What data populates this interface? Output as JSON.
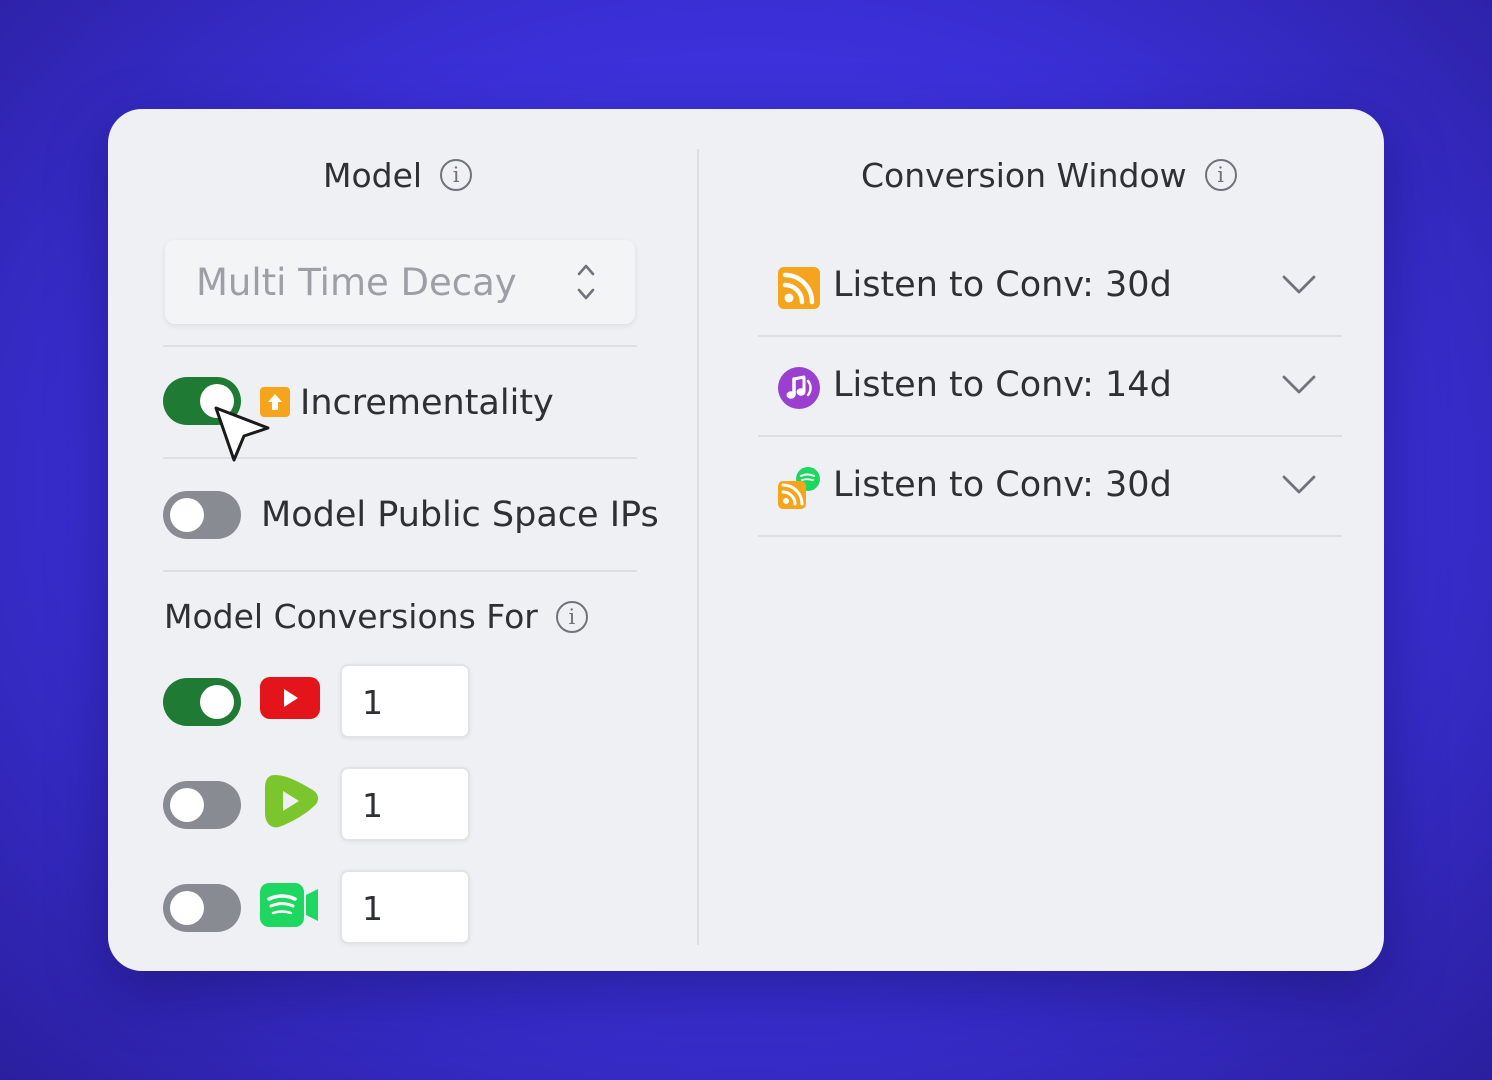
{
  "colors": {
    "background": "#3b30d8",
    "card": "#eef0f3",
    "toggle_on": "#1f7a33",
    "toggle_off": "#888b92"
  },
  "model": {
    "title": "Model",
    "info_icon": "info-icon",
    "select_value": "Multi Time Decay",
    "incrementality": {
      "label": "Incrementality",
      "enabled": true,
      "badge_icon": "arrow-up-badge-icon"
    },
    "public_space": {
      "label": "Model Public Space IPs",
      "enabled": false
    }
  },
  "conversions": {
    "title": "Model Conversions For",
    "info_icon": "info-icon",
    "rows": [
      {
        "icon": "youtube-icon",
        "enabled": true,
        "value": "1"
      },
      {
        "icon": "rumble-icon",
        "enabled": false,
        "value": "1"
      },
      {
        "icon": "spotify-video-icon",
        "enabled": false,
        "value": "1"
      }
    ]
  },
  "conversion_window": {
    "title": "Conversion Window",
    "info_icon": "info-icon",
    "items": [
      {
        "icon": "rss-icon",
        "label": "Listen to Conv: 30d"
      },
      {
        "icon": "apple-podcasts-icon",
        "label": "Listen to Conv: 14d"
      },
      {
        "icon": "rss-spotify-icon",
        "label": "Listen to Conv: 30d"
      }
    ]
  }
}
